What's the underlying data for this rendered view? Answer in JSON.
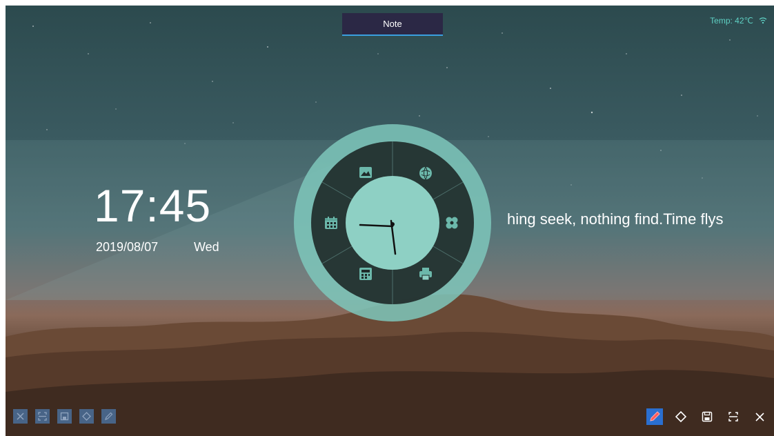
{
  "window": {
    "tab_label": "Note"
  },
  "status": {
    "temperature": "Temp: 42℃",
    "wifi_icon": "wifi-icon"
  },
  "clock": {
    "time": "17:45",
    "date": "2019/08/07",
    "weekday": "Wed"
  },
  "quote": {
    "text": "hing seek, nothing find.Time flys"
  },
  "dial": {
    "segments": [
      {
        "name": "gallery",
        "icon": "image-icon"
      },
      {
        "name": "browser",
        "icon": "globe-icon"
      },
      {
        "name": "apps",
        "icon": "clover-icon"
      },
      {
        "name": "printer",
        "icon": "printer-icon"
      },
      {
        "name": "calculator",
        "icon": "calculator-icon"
      },
      {
        "name": "calendar",
        "icon": "calendar-icon"
      }
    ],
    "colors": {
      "ring": "#7ec7bb",
      "dark": "#1f2b2a",
      "face": "#8ed0c4",
      "icon": "#6cb8ab"
    }
  },
  "toolbar_left": [
    {
      "icon": "close-icon"
    },
    {
      "icon": "fullscreen-icon"
    },
    {
      "icon": "save-icon"
    },
    {
      "icon": "eraser-icon"
    },
    {
      "icon": "pen-icon"
    }
  ],
  "toolbar_right": [
    {
      "icon": "pen-icon"
    },
    {
      "icon": "eraser-icon"
    },
    {
      "icon": "save-icon"
    },
    {
      "icon": "fullscreen-icon"
    },
    {
      "icon": "close-icon"
    }
  ]
}
